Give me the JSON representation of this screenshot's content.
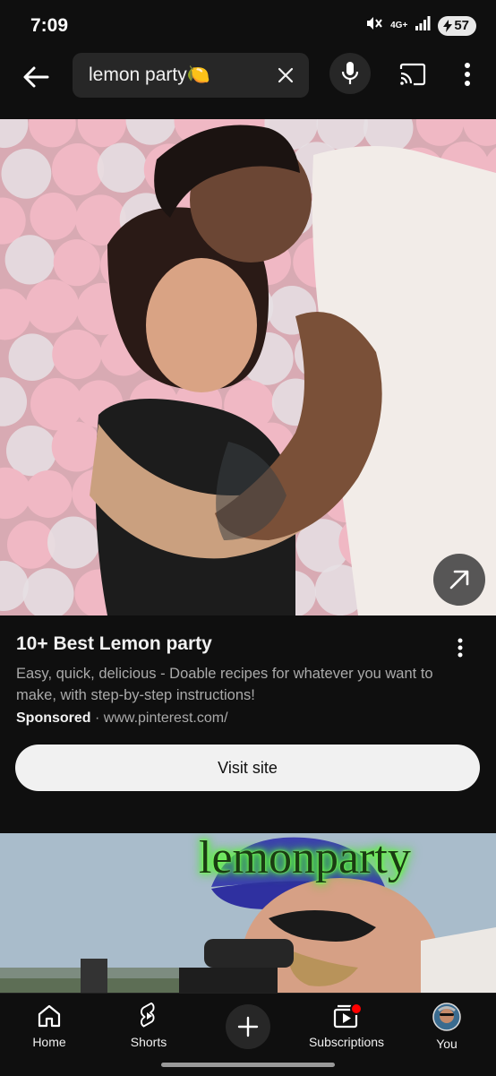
{
  "status": {
    "time": "7:09",
    "network": "4G+",
    "battery": "57"
  },
  "search": {
    "query": "lemon party🍋"
  },
  "ad": {
    "title": "10+ Best Lemon party",
    "description": "Easy, quick, delicious - Doable recipes for whatever you want to make, with step-by-step instructions!",
    "sponsored": "Sponsored",
    "separator": "·",
    "domain": "www.pinterest.com/",
    "cta": "Visit site"
  },
  "video": {
    "thumbnail_text": "lemonparty"
  },
  "nav": {
    "items": [
      {
        "label": "Home"
      },
      {
        "label": "Shorts"
      },
      {
        "label": "Subscriptions"
      },
      {
        "label": "You"
      }
    ]
  },
  "colors": {
    "background": "#0f0f0f",
    "surface": "#272727",
    "text_primary": "#f1f1f1",
    "text_secondary": "#aaaaaa",
    "notification_dot": "#ff0000",
    "thumbnail_glow": "#4cff2a"
  }
}
